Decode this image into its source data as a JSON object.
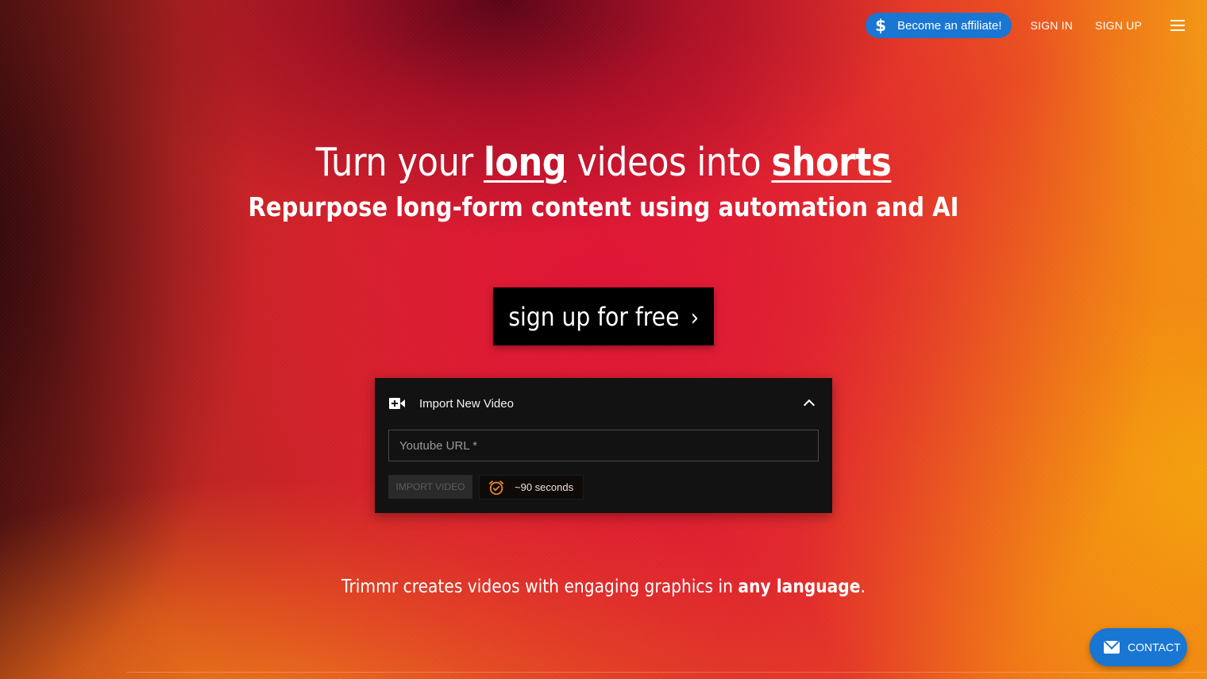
{
  "header": {
    "affiliate_icon": "dollar-icon",
    "affiliate_label": "Become an affiliate!",
    "sign_in_label": "SIGN IN",
    "sign_up_label": "SIGN UP",
    "menu_icon": "hamburger-menu-icon"
  },
  "hero": {
    "title_part1": "Turn your ",
    "title_em1": "long",
    "title_part2": " videos into ",
    "title_em2": "shorts",
    "subtitle": "Repurpose long-form content using automation and AI",
    "cta_label": "sign up for free",
    "cta_icon": "chevron-right-icon"
  },
  "import_card": {
    "header_icon": "video-plus-icon",
    "title": "Import New Video",
    "collapse_icon": "chevron-up-icon",
    "url_placeholder": "Youtube URL *",
    "url_value": "",
    "import_button_label": "IMPORT VIDEO",
    "import_button_disabled": true,
    "time_icon": "alarm-clock-icon",
    "time_estimate": "~90 seconds"
  },
  "tagline": {
    "text_before": "Trimmr creates videos with engaging graphics in ",
    "text_bold": "any language",
    "text_after": "."
  },
  "contact": {
    "icon": "mail-icon",
    "label": "CONTACT"
  },
  "colors": {
    "accent_blue": "#1976d2",
    "card_bg": "#121212",
    "alarm_orange": "#e8862a"
  }
}
